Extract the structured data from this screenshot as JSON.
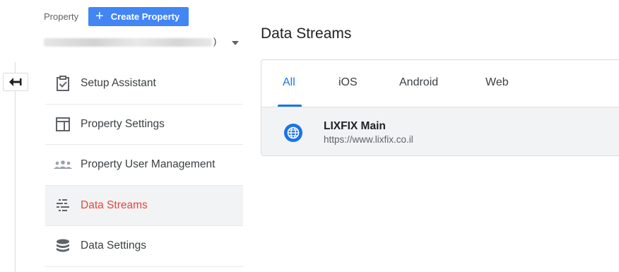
{
  "property": {
    "label": "Property",
    "create_button": "Create Property",
    "select_suffix": ")"
  },
  "menu": {
    "items": [
      {
        "label": "Setup Assistant",
        "icon": "clipboard-check-icon"
      },
      {
        "label": "Property Settings",
        "icon": "layout-icon"
      },
      {
        "label": "Property User Management",
        "icon": "people-icon"
      },
      {
        "label": "Data Streams",
        "icon": "data-streams-icon",
        "active": true
      },
      {
        "label": "Data Settings",
        "icon": "database-icon"
      }
    ]
  },
  "main": {
    "title": "Data Streams",
    "tabs": [
      {
        "label": "All",
        "active": true
      },
      {
        "label": "iOS"
      },
      {
        "label": "Android"
      },
      {
        "label": "Web"
      }
    ],
    "streams": [
      {
        "name": "LIXFIX Main",
        "url": "https://www.lixfix.co.il",
        "icon": "globe-icon"
      }
    ]
  },
  "colors": {
    "accent": "#1a73e8",
    "create_button": "#4285f4",
    "active_menu_text": "#e8453c",
    "active_menu_bg": "#f1f3f4"
  }
}
